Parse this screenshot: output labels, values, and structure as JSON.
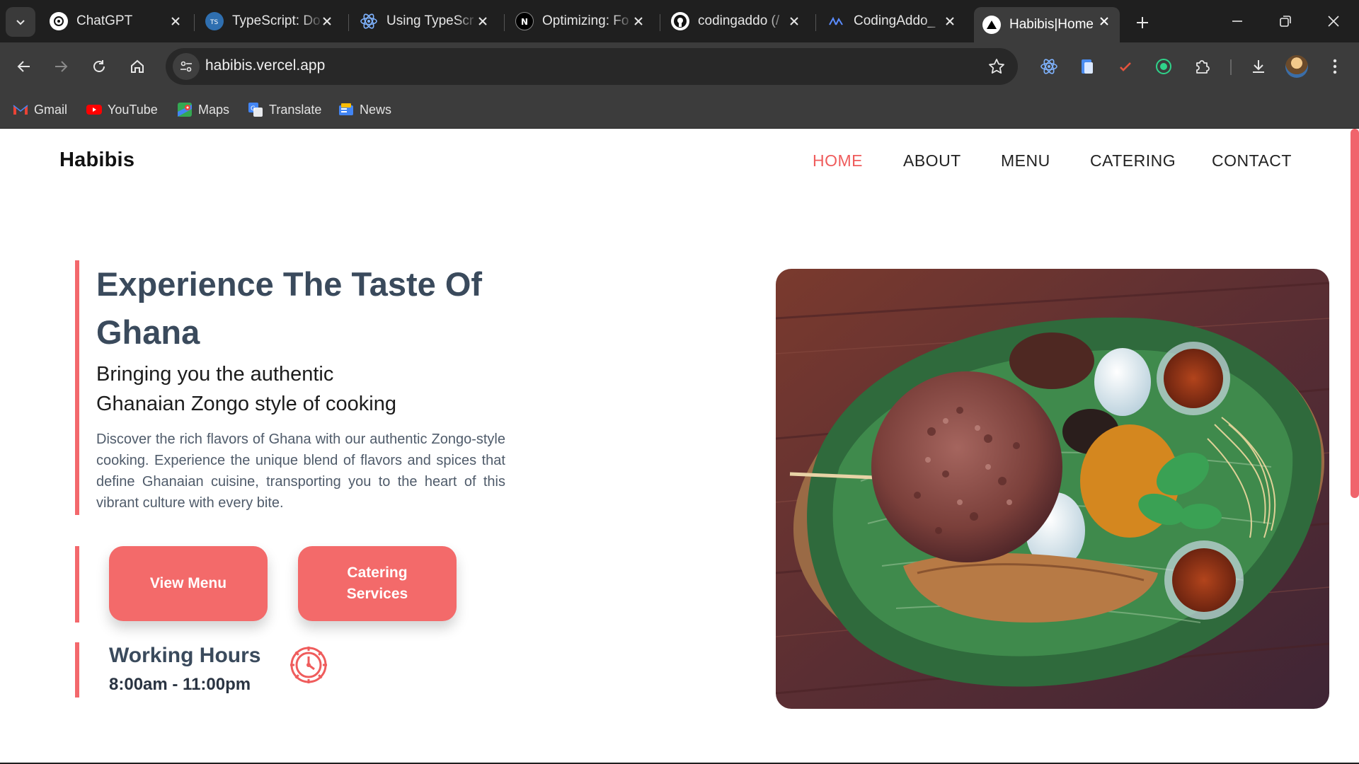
{
  "browser": {
    "tabs": [
      {
        "title": "ChatGPT",
        "icon": "chatgpt-icon"
      },
      {
        "title": "TypeScript: Do",
        "icon": "typescript-icon"
      },
      {
        "title": "Using TypeScr",
        "icon": "react-icon"
      },
      {
        "title": "Optimizing: Fo",
        "icon": "nextjs-icon"
      },
      {
        "title": "codingaddo (/",
        "icon": "github-icon"
      },
      {
        "title": "CodingAddo_",
        "icon": "codingaddo-icon"
      },
      {
        "title": "Habibis|Home",
        "icon": "vercel-icon"
      }
    ],
    "address": "habibis.vercel.app",
    "bookmarks": [
      {
        "label": "Gmail",
        "icon": "gmail-icon"
      },
      {
        "label": "YouTube",
        "icon": "youtube-icon"
      },
      {
        "label": "Maps",
        "icon": "maps-icon"
      },
      {
        "label": "Translate",
        "icon": "translate-icon"
      },
      {
        "label": "News",
        "icon": "news-icon"
      }
    ]
  },
  "site": {
    "brand": "Habibis",
    "nav": [
      "HOME",
      "ABOUT",
      "MENU",
      "CATERING",
      "CONTACT"
    ],
    "hero": {
      "title": "Experience The Taste Of Ghana",
      "subtitle_line1": "Bringing you the authentic",
      "subtitle_line2": "Ghanaian Zongo style of cooking",
      "description": "Discover the rich flavors of Ghana with our authentic Zongo-style cooking. Experience the unique blend of flavors and spices that define Ghanaian cuisine, transporting you to the heart of this vibrant culture with every bite."
    },
    "buttons": {
      "view_menu": "View Menu",
      "catering": "Catering Services"
    },
    "hours": {
      "title": "Working Hours",
      "time": "8:00am - 11:00pm"
    }
  },
  "colors": {
    "accent": "#f36a6a",
    "heading": "#3a4a5c",
    "chrome_dark": "#1f1f1f",
    "chrome_mid": "#3c3c3c"
  }
}
